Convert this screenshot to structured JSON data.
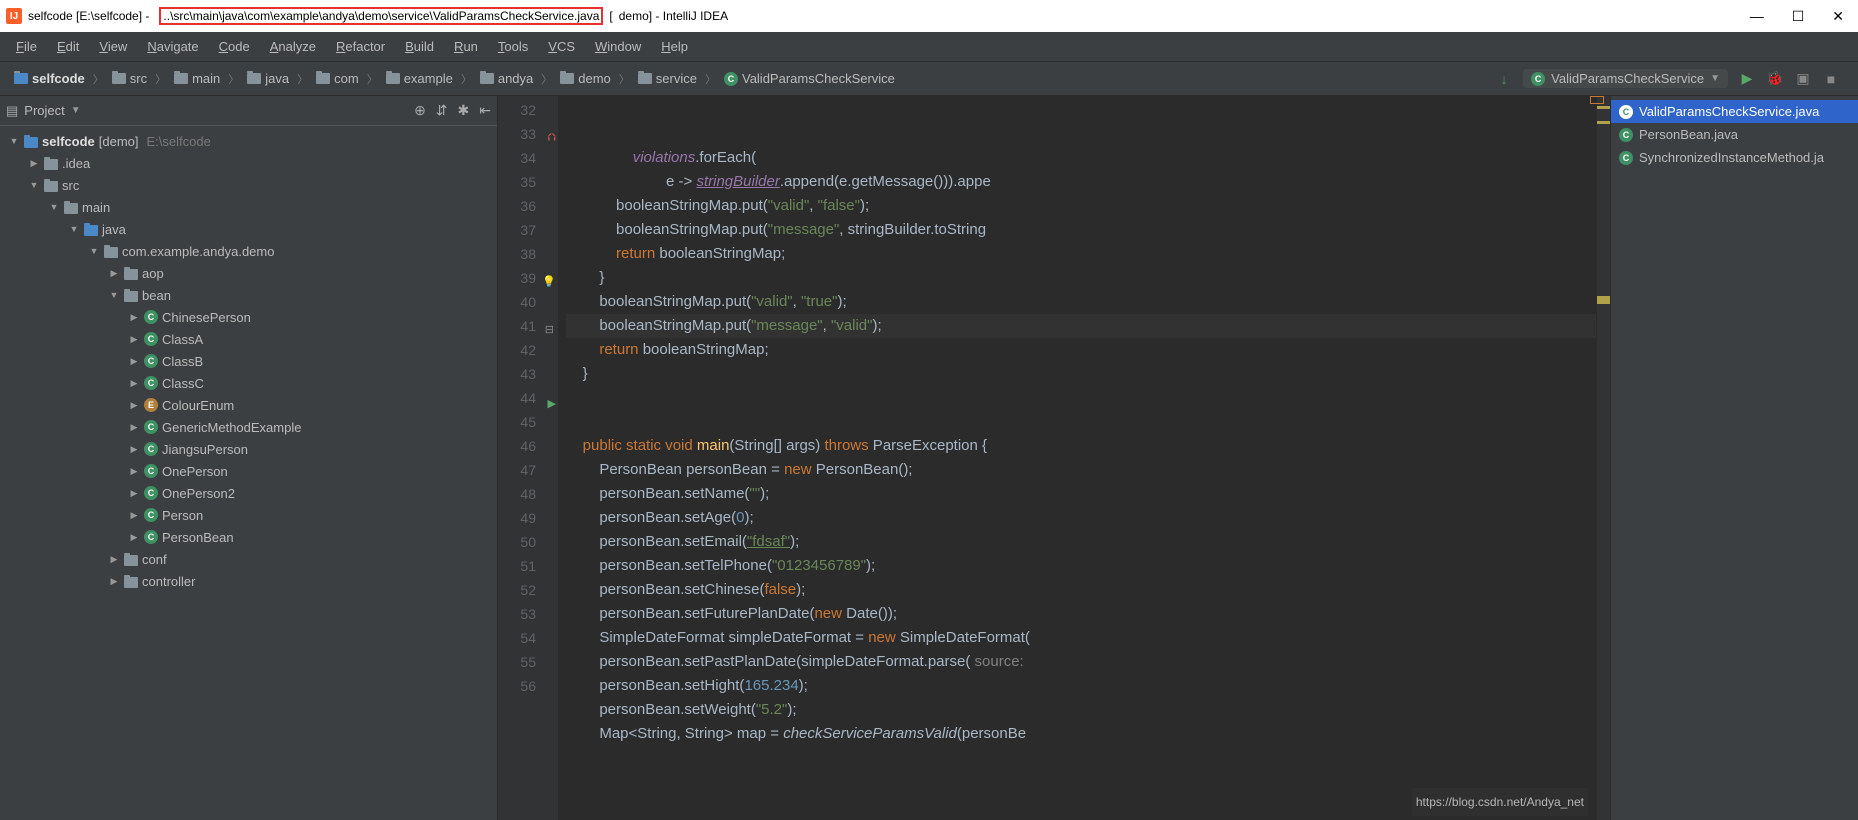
{
  "title": {
    "prefix": "selfcode [E:\\selfcode] - ",
    "highlight_path": "..\\src\\main\\java\\com\\example\\andya\\demo\\service\\ValidParamsCheckService.java",
    "suffix1": " [",
    "suffix2": "demo] - IntelliJ IDEA"
  },
  "menu": [
    "File",
    "Edit",
    "View",
    "Navigate",
    "Code",
    "Analyze",
    "Refactor",
    "Build",
    "Run",
    "Tools",
    "VCS",
    "Window",
    "Help"
  ],
  "breadcrumbs": [
    {
      "icon": "proj",
      "label": "selfcode",
      "bold": true
    },
    {
      "icon": "folder",
      "label": "src"
    },
    {
      "icon": "folder",
      "label": "main"
    },
    {
      "icon": "folder",
      "label": "java"
    },
    {
      "icon": "folder",
      "label": "com"
    },
    {
      "icon": "folder",
      "label": "example"
    },
    {
      "icon": "folder",
      "label": "andya"
    },
    {
      "icon": "folder",
      "label": "demo"
    },
    {
      "icon": "folder",
      "label": "service"
    },
    {
      "icon": "class",
      "label": "ValidParamsCheckService"
    }
  ],
  "run_selector": "ValidParamsCheckService",
  "sidebar": {
    "header": "Project",
    "tree": [
      {
        "indent": 8,
        "arrow": "▼",
        "icon": "proj",
        "label": "selfcode",
        "extra": "[demo]",
        "path": "E:\\selfcode",
        "bold": true
      },
      {
        "indent": 28,
        "arrow": "▶",
        "icon": "folder",
        "label": ".idea"
      },
      {
        "indent": 28,
        "arrow": "▼",
        "icon": "folder",
        "label": "src"
      },
      {
        "indent": 48,
        "arrow": "▼",
        "icon": "folder",
        "label": "main"
      },
      {
        "indent": 68,
        "arrow": "▼",
        "icon": "folder-blue",
        "label": "java"
      },
      {
        "indent": 88,
        "arrow": "▼",
        "icon": "pkg",
        "label": "com.example.andya.demo"
      },
      {
        "indent": 108,
        "arrow": "▶",
        "icon": "pkg",
        "label": "aop"
      },
      {
        "indent": 108,
        "arrow": "▼",
        "icon": "pkg",
        "label": "bean"
      },
      {
        "indent": 128,
        "arrow": "▶",
        "icon": "cls",
        "label": "ChinesePerson"
      },
      {
        "indent": 128,
        "arrow": "▶",
        "icon": "cls",
        "label": "ClassA"
      },
      {
        "indent": 128,
        "arrow": "▶",
        "icon": "cls",
        "label": "ClassB"
      },
      {
        "indent": 128,
        "arrow": "▶",
        "icon": "cls",
        "label": "ClassC"
      },
      {
        "indent": 128,
        "arrow": "▶",
        "icon": "enum",
        "label": "ColourEnum"
      },
      {
        "indent": 128,
        "arrow": "▶",
        "icon": "cls",
        "label": "GenericMethodExample"
      },
      {
        "indent": 128,
        "arrow": "▶",
        "icon": "cls",
        "label": "JiangsuPerson"
      },
      {
        "indent": 128,
        "arrow": "▶",
        "icon": "cls",
        "label": "OnePerson"
      },
      {
        "indent": 128,
        "arrow": "▶",
        "icon": "cls",
        "label": "OnePerson2"
      },
      {
        "indent": 128,
        "arrow": "▶",
        "icon": "cls",
        "label": "Person"
      },
      {
        "indent": 128,
        "arrow": "▶",
        "icon": "cls",
        "label": "PersonBean"
      },
      {
        "indent": 108,
        "arrow": "▶",
        "icon": "pkg",
        "label": "conf"
      },
      {
        "indent": 108,
        "arrow": "▶",
        "icon": "pkg",
        "label": "controller"
      }
    ]
  },
  "gutter": {
    "start": 32,
    "end": 56,
    "icons": {
      "33": "red",
      "39": "bulb",
      "44": "play",
      "41": "fold"
    }
  },
  "code_lines": [
    {
      "n": 32,
      "html": "                <span class='fld'>violations</span>.forEach("
    },
    {
      "n": 33,
      "html": "                        e -> <span class='fld ul'>stringBuilder</span>.append(e.getMessage())).appe"
    },
    {
      "n": 34,
      "html": "            booleanStringMap.put(<span class='str'>\"valid\"</span>, <span class='str'>\"false\"</span>);"
    },
    {
      "n": 35,
      "html": "            booleanStringMap.put(<span class='str'>\"message\"</span>, stringBuilder.toString"
    },
    {
      "n": 36,
      "html": "            <span class='kw'>return</span> booleanStringMap;"
    },
    {
      "n": 37,
      "html": "        }"
    },
    {
      "n": 38,
      "html": "        booleanStringMap.put(<span class='str'>\"valid\"</span>, <span class='str'>\"true\"</span>);"
    },
    {
      "n": 39,
      "cur": true,
      "html": "        booleanStringMap.put(<span class='str'>\"message\"</span>, <span class='str'>\"valid\"</span>);"
    },
    {
      "n": 40,
      "html": "        <span class='kw'>return</span> booleanStringMap;"
    },
    {
      "n": 41,
      "html": "    }"
    },
    {
      "n": 42,
      "html": ""
    },
    {
      "n": 43,
      "html": ""
    },
    {
      "n": 44,
      "html": "    <span class='kw'>public static void</span> <span class='fn'>main</span>(String[] args) <span class='kw'>throws</span> ParseException {"
    },
    {
      "n": 45,
      "html": "        PersonBean personBean = <span class='kw'>new</span> PersonBean();"
    },
    {
      "n": 46,
      "html": "        personBean.setName(<span class='str'>\"\"</span>);"
    },
    {
      "n": 47,
      "html": "        personBean.setAge(<span class='num'>0</span>);"
    },
    {
      "n": 48,
      "html": "        personBean.setEmail(<span class='str ul'>\"fdsaf\"</span>);"
    },
    {
      "n": 49,
      "html": "        personBean.setTelPhone(<span class='str'>\"0123456789\"</span>);"
    },
    {
      "n": 50,
      "html": "        personBean.setChinese(<span class='kw'>false</span>);"
    },
    {
      "n": 51,
      "html": "        personBean.setFuturePlanDate(<span class='kw'>new</span> Date());"
    },
    {
      "n": 52,
      "html": "        SimpleDateFormat simpleDateFormat = <span class='kw'>new</span> SimpleDateFormat("
    },
    {
      "n": 53,
      "html": "        personBean.setPastPlanDate(simpleDateFormat.parse( <span class='cmt'>source:</span>"
    },
    {
      "n": 54,
      "html": "        personBean.setHight(<span class='num'>165.234</span>);"
    },
    {
      "n": 55,
      "html": "        personBean.setWeight(<span class='str'>\"5.2\"</span>);"
    },
    {
      "n": 56,
      "html": "        Map&lt;String, String&gt; map = <span class='ital'>checkServiceParamsValid</span>(personBe"
    }
  ],
  "recent_files": [
    {
      "label": "ValidParamsCheckService.java",
      "active": true
    },
    {
      "label": "PersonBean.java",
      "active": false
    },
    {
      "label": "SynchronizedInstanceMethod.ja",
      "active": false
    }
  ],
  "watermark": "https://blog.csdn.net/Andya_net"
}
